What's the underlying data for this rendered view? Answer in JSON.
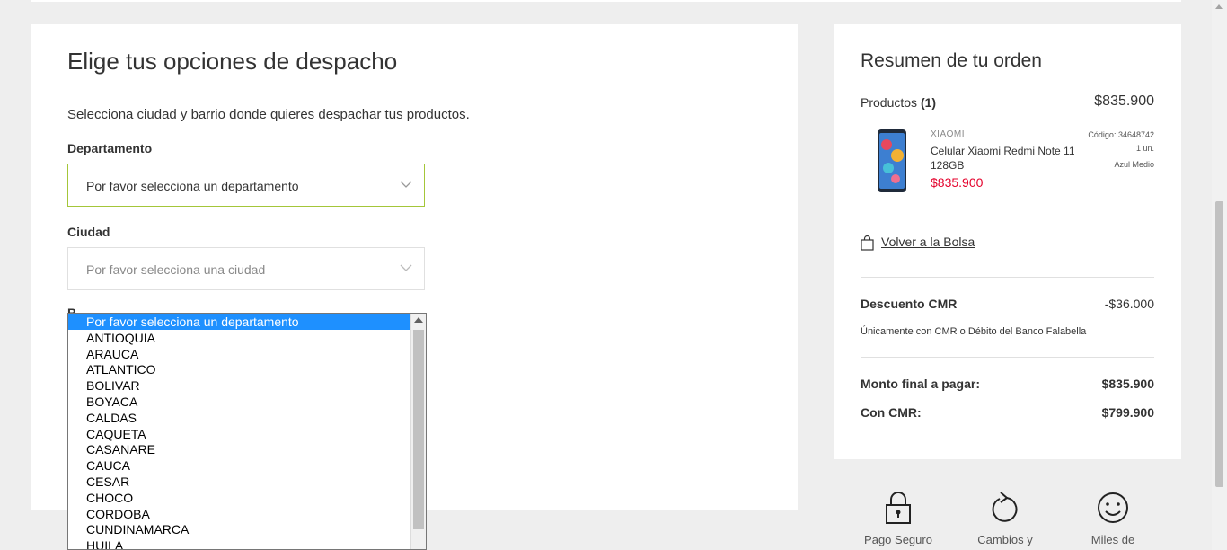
{
  "shipping": {
    "title": "Elige tus opciones de despacho",
    "intro": "Selecciona ciudad y barrio donde quieres despachar tus productos.",
    "departamento_label": "Departamento",
    "departamento_placeholder": "Por favor selecciona un departamento",
    "ciudad_label": "Ciudad",
    "ciudad_placeholder": "Por favor selecciona una ciudad",
    "barrio_label_partial": "B"
  },
  "dropdown": {
    "options": [
      "Por favor selecciona un departamento",
      "ANTIOQUIA",
      "ARAUCA",
      "ATLANTICO",
      "BOLIVAR",
      "BOYACA",
      "CALDAS",
      "CAQUETA",
      "CASANARE",
      "CAUCA",
      "CESAR",
      "CHOCO",
      "CORDOBA",
      "CUNDINAMARCA",
      "HUILA"
    ],
    "selected_index": 0
  },
  "summary": {
    "title": "Resumen de tu orden",
    "products_label": "Productos",
    "products_count": "(1)",
    "products_total": "$835.900",
    "item": {
      "brand": "XIAOMI",
      "name": "Celular Xiaomi Redmi Note 11 128GB",
      "price": "$835.900",
      "code": "Código: 34648742",
      "qty": "1 un.",
      "color": "Azul Medio"
    },
    "back_to_bag": "Volver a la Bolsa",
    "discount_label": "Descuento CMR",
    "discount_value": "-$36.000",
    "discount_note": "Únicamente con CMR o Débito del Banco Falabella",
    "final_label": "Monto final a pagar:",
    "final_value": "$835.900",
    "cmr_label": "Con CMR:",
    "cmr_value": "$799.900"
  },
  "badges": [
    {
      "icon": "lock-icon",
      "label": "Pago Seguro"
    },
    {
      "icon": "refresh-icon",
      "label": "Cambios y"
    },
    {
      "icon": "smile-icon",
      "label": "Miles de"
    }
  ],
  "colors": {
    "accent_border": "#a4c639",
    "price_red": "#e4002b",
    "selection_blue": "#1e90ff"
  }
}
